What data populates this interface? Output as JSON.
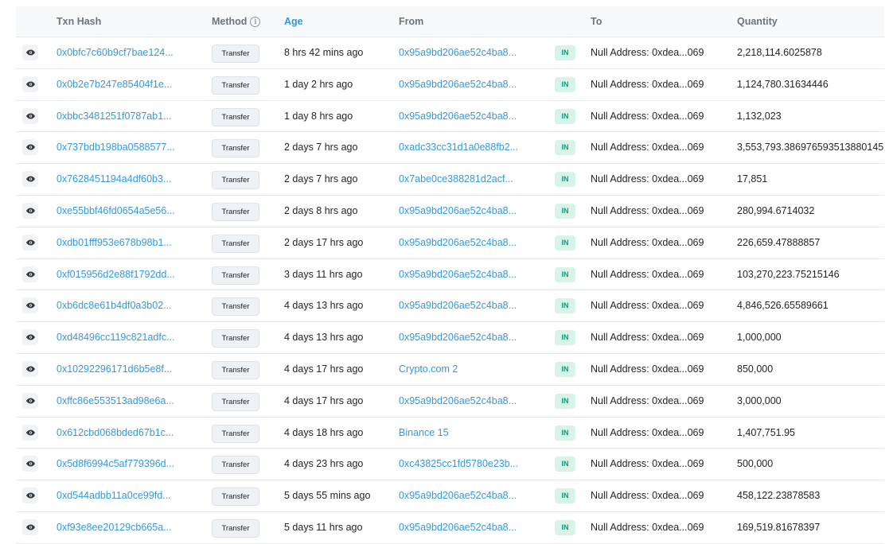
{
  "headers": {
    "txn_hash": "Txn Hash",
    "method": "Method",
    "age": "Age",
    "from": "From",
    "to": "To",
    "quantity": "Quantity"
  },
  "icons": {
    "eye": "eye-icon",
    "info": "info-circle-icon"
  },
  "colors": {
    "link": "#3498db",
    "in_badge_bg": "#d8f3e7",
    "in_badge_text": "#00a186",
    "header_bg": "#f8f9fa"
  },
  "rows": [
    {
      "hash": "0x0bfc7c60b9cf7bae124...",
      "method": "Transfer",
      "age": "8 hrs 42 mins ago",
      "from": "0x95a9bd206ae52c4ba8...",
      "direction": "IN",
      "to": "Null Address: 0xdea...069",
      "quantity": "2,218,114.6025878"
    },
    {
      "hash": "0x0b2e7b247e85404f1e...",
      "method": "Transfer",
      "age": "1 day 2 hrs ago",
      "from": "0x95a9bd206ae52c4ba8...",
      "direction": "IN",
      "to": "Null Address: 0xdea...069",
      "quantity": "1,124,780.31634446"
    },
    {
      "hash": "0xbbc3481251f0787ab1...",
      "method": "Transfer",
      "age": "1 day 8 hrs ago",
      "from": "0x95a9bd206ae52c4ba8...",
      "direction": "IN",
      "to": "Null Address: 0xdea...069",
      "quantity": "1,132,023"
    },
    {
      "hash": "0x737bdb198ba0588577...",
      "method": "Transfer",
      "age": "2 days 7 hrs ago",
      "from": "0xadc33cc31d1a0e88fb2...",
      "direction": "IN",
      "to": "Null Address: 0xdea...069",
      "quantity": "3,553,793.386976593513880145"
    },
    {
      "hash": "0x7628451194a4df60b3...",
      "method": "Transfer",
      "age": "2 days 7 hrs ago",
      "from": "0x7abe0ce388281d2acf...",
      "direction": "IN",
      "to": "Null Address: 0xdea...069",
      "quantity": "17,851"
    },
    {
      "hash": "0xe55bbf46fd0654a5e56...",
      "method": "Transfer",
      "age": "2 days 8 hrs ago",
      "from": "0x95a9bd206ae52c4ba8...",
      "direction": "IN",
      "to": "Null Address: 0xdea...069",
      "quantity": "280,994.6714032"
    },
    {
      "hash": "0xdb01fff953e678b98b1...",
      "method": "Transfer",
      "age": "2 days 17 hrs ago",
      "from": "0x95a9bd206ae52c4ba8...",
      "direction": "IN",
      "to": "Null Address: 0xdea...069",
      "quantity": "226,659.47888857"
    },
    {
      "hash": "0xf015956d2e88f1792dd...",
      "method": "Transfer",
      "age": "3 days 11 hrs ago",
      "from": "0x95a9bd206ae52c4ba8...",
      "direction": "IN",
      "to": "Null Address: 0xdea...069",
      "quantity": "103,270,223.75215146"
    },
    {
      "hash": "0xb6dc8e61b4df0a3b02...",
      "method": "Transfer",
      "age": "4 days 13 hrs ago",
      "from": "0x95a9bd206ae52c4ba8...",
      "direction": "IN",
      "to": "Null Address: 0xdea...069",
      "quantity": "4,846,526.65589661"
    },
    {
      "hash": "0xd48496cc119c821adfc...",
      "method": "Transfer",
      "age": "4 days 13 hrs ago",
      "from": "0x95a9bd206ae52c4ba8...",
      "direction": "IN",
      "to": "Null Address: 0xdea...069",
      "quantity": "1,000,000"
    },
    {
      "hash": "0x10292296171d6b5e8f...",
      "method": "Transfer",
      "age": "4 days 17 hrs ago",
      "from": "Crypto.com 2",
      "direction": "IN",
      "to": "Null Address: 0xdea...069",
      "quantity": "850,000"
    },
    {
      "hash": "0xffc86e553513ad98e6a...",
      "method": "Transfer",
      "age": "4 days 17 hrs ago",
      "from": "0x95a9bd206ae52c4ba8...",
      "direction": "IN",
      "to": "Null Address: 0xdea...069",
      "quantity": "3,000,000"
    },
    {
      "hash": "0x612cbd068bded67b1c...",
      "method": "Transfer",
      "age": "4 days 18 hrs ago",
      "from": "Binance 15",
      "direction": "IN",
      "to": "Null Address: 0xdea...069",
      "quantity": "1,407,751.95"
    },
    {
      "hash": "0x5d8f6994c5af779396d...",
      "method": "Transfer",
      "age": "4 days 23 hrs ago",
      "from": "0xc43825cc1fd5780e23b...",
      "direction": "IN",
      "to": "Null Address: 0xdea...069",
      "quantity": "500,000"
    },
    {
      "hash": "0xd544adbb11a0ce99fd...",
      "method": "Transfer",
      "age": "5 days 55 mins ago",
      "from": "0x95a9bd206ae52c4ba8...",
      "direction": "IN",
      "to": "Null Address: 0xdea...069",
      "quantity": "458,122.23878583"
    },
    {
      "hash": "0xf93e8ee20129cb665a...",
      "method": "Transfer",
      "age": "5 days 11 hrs ago",
      "from": "0x95a9bd206ae52c4ba8...",
      "direction": "IN",
      "to": "Null Address: 0xdea...069",
      "quantity": "169,519.81678397"
    }
  ]
}
